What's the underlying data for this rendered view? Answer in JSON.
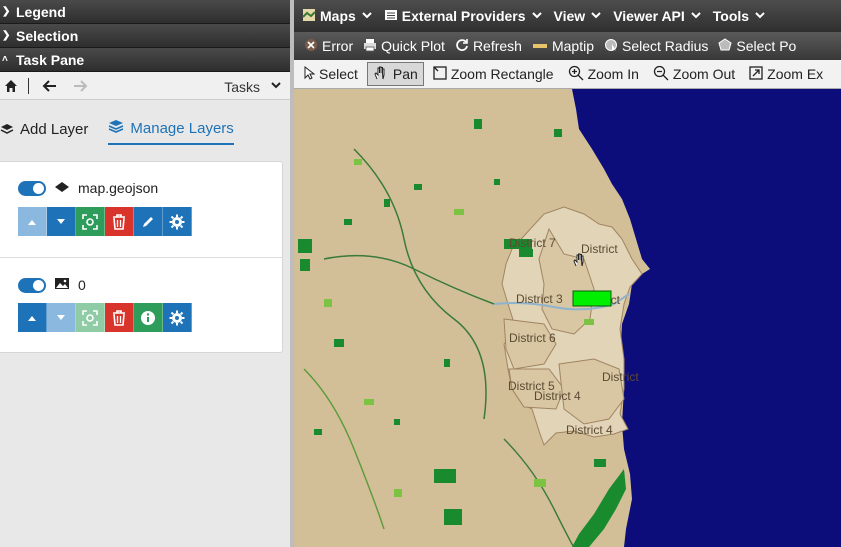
{
  "left_panel": {
    "accordion": [
      {
        "label": "Legend",
        "state": "collapsed"
      },
      {
        "label": "Selection",
        "state": "collapsed"
      },
      {
        "label": "Task Pane",
        "state": "expanded"
      }
    ],
    "taskbar": {
      "tasks_label": "Tasks"
    },
    "tabs": {
      "add_layer": "Add Layer",
      "manage_layers": "Manage Layers"
    },
    "layers": [
      {
        "name": "map.geojson",
        "visible": true,
        "type_icon": "vector-layer-icon"
      },
      {
        "name": "0",
        "visible": true,
        "type_icon": "raster-layer-icon"
      }
    ]
  },
  "menubar": {
    "items": [
      "Maps",
      "External Providers",
      "View",
      "Viewer API",
      "Tools"
    ]
  },
  "toolbar": {
    "items": [
      "Error",
      "Quick Plot",
      "Refresh",
      "Maptip",
      "Select Radius",
      "Select Po"
    ]
  },
  "map_toolbar": {
    "items": [
      "Select",
      "Pan",
      "Zoom Rectangle",
      "Zoom In",
      "Zoom Out",
      "Zoom Ex"
    ],
    "active": "Pan"
  },
  "map": {
    "districts": [
      "District 7",
      "District",
      "District 3",
      "rict",
      "District 6",
      "District",
      "District 5",
      "District 4",
      "District 4"
    ],
    "colors": {
      "land": "#d2bf98",
      "water": "#0c0c7a",
      "forest": "#1a8a2e",
      "highlight": "#00ee00"
    }
  }
}
